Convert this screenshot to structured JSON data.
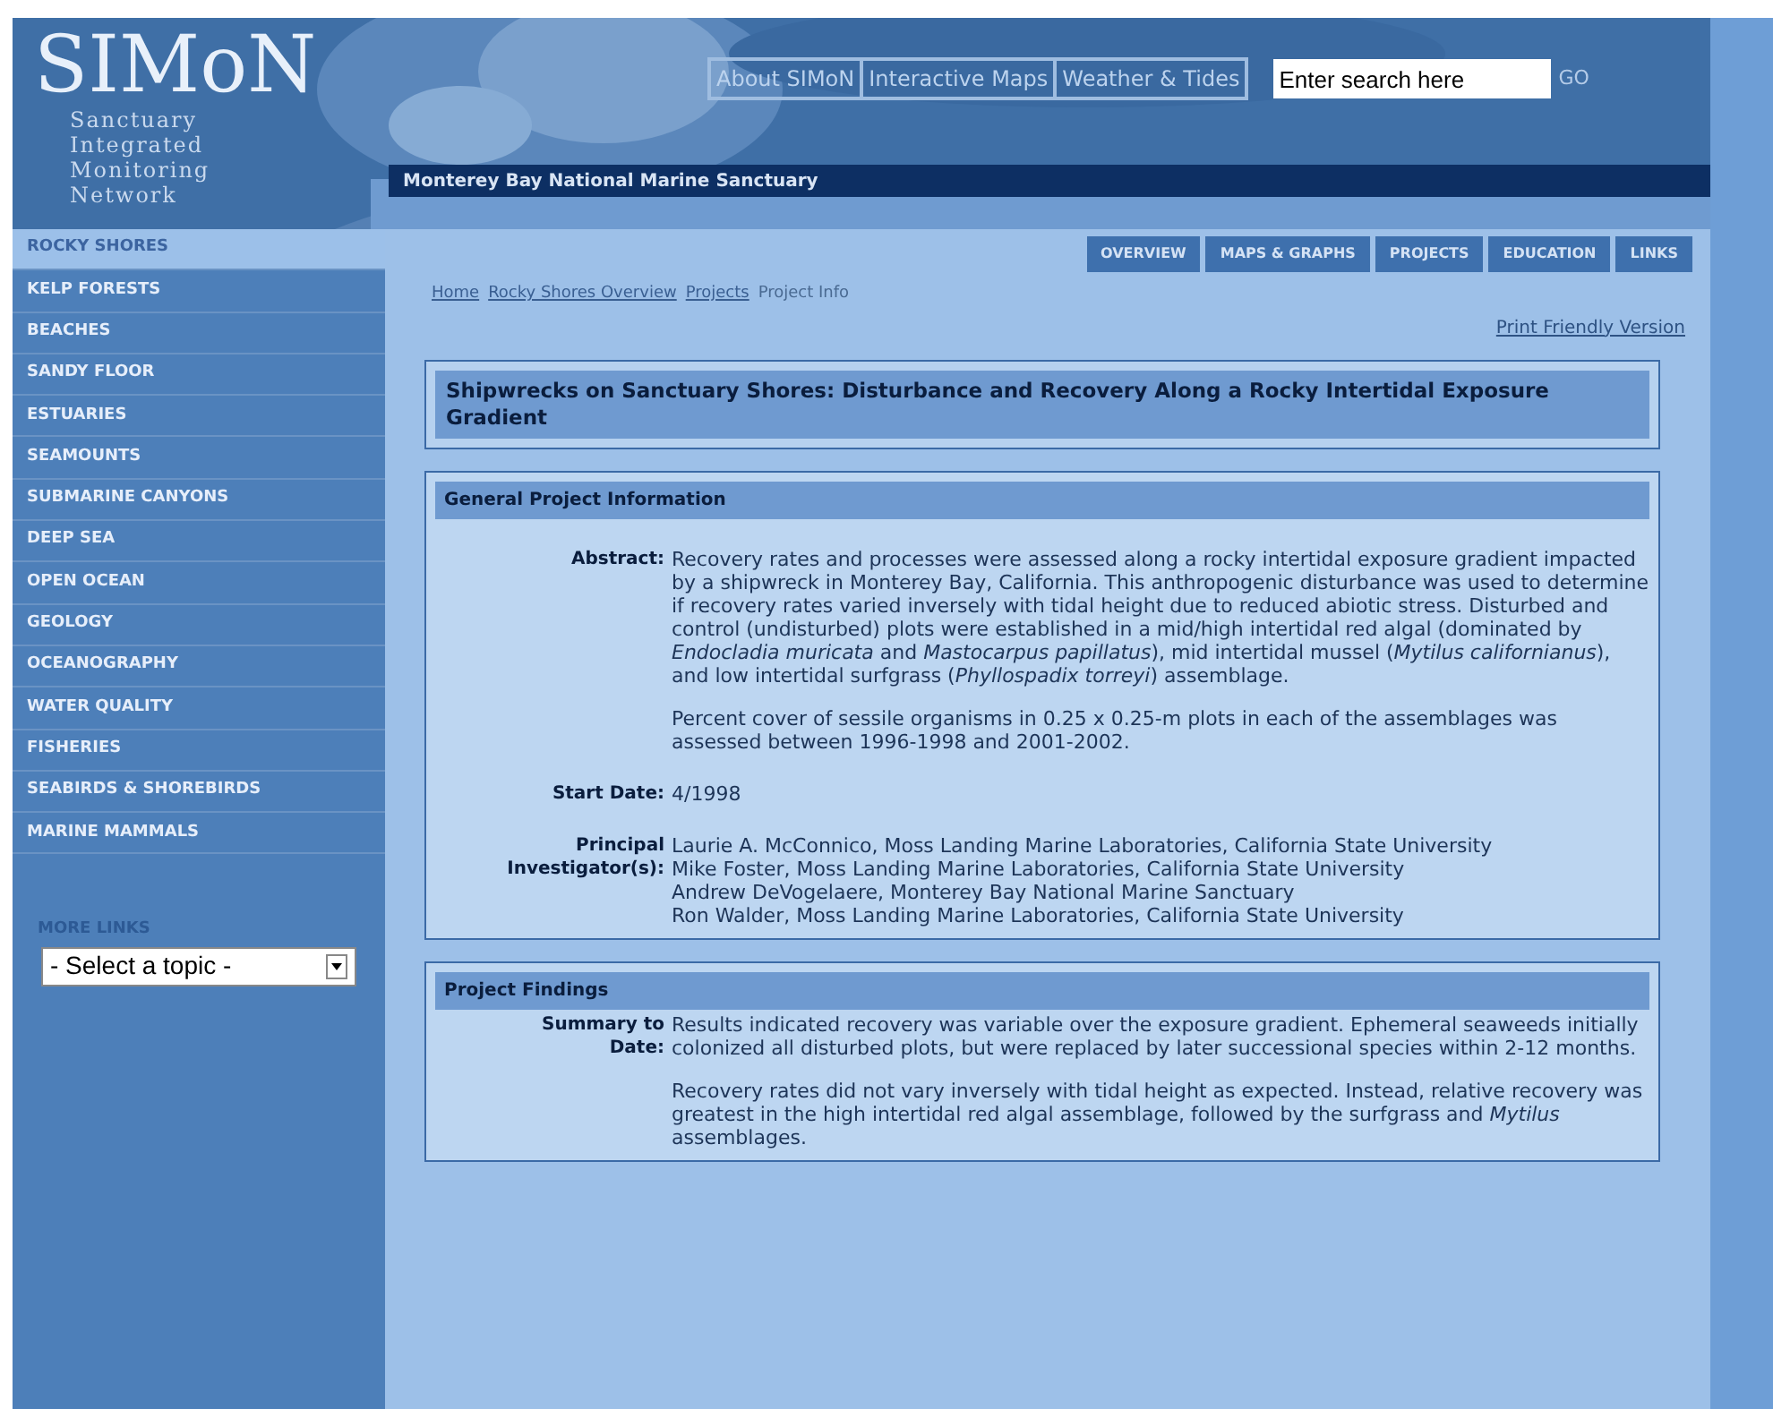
{
  "logo": {
    "title": "SIMoN",
    "subtitle": [
      "Sanctuary",
      "Integrated",
      "Monitoring",
      "Network"
    ]
  },
  "top_links": [
    "About SIMoN",
    "Interactive Maps",
    "Weather & Tides"
  ],
  "search": {
    "placeholder": "Enter search here",
    "button": "GO"
  },
  "banner": "Monterey Bay National Marine Sanctuary",
  "tabs": [
    {
      "label": "OVERVIEW",
      "selected": false
    },
    {
      "label": "MAPS & GRAPHS",
      "selected": false
    },
    {
      "label": "PROJECTS",
      "selected": false
    },
    {
      "label": "EDUCATION",
      "selected": false
    },
    {
      "label": "LINKS",
      "selected": false
    }
  ],
  "sidebar": {
    "items": [
      {
        "label": "ROCKY SHORES",
        "selected": true
      },
      {
        "label": "KELP FORESTS",
        "selected": false
      },
      {
        "label": "BEACHES",
        "selected": false
      },
      {
        "label": "SANDY FLOOR",
        "selected": false
      },
      {
        "label": "ESTUARIES",
        "selected": false
      },
      {
        "label": "SEAMOUNTS",
        "selected": false
      },
      {
        "label": "SUBMARINE CANYONS",
        "selected": false
      },
      {
        "label": "DEEP SEA",
        "selected": false
      },
      {
        "label": "OPEN OCEAN",
        "selected": false
      },
      {
        "label": "GEOLOGY",
        "selected": false
      },
      {
        "label": "OCEANOGRAPHY",
        "selected": false
      },
      {
        "label": "WATER QUALITY",
        "selected": false
      },
      {
        "label": "FISHERIES",
        "selected": false
      },
      {
        "label": "SEABIRDS & SHOREBIRDS",
        "selected": false
      },
      {
        "label": "MARINE MAMMALS",
        "selected": false
      }
    ],
    "more_links": {
      "label": "MORE LINKS",
      "value": "- Select a topic -"
    }
  },
  "breadcrumb": [
    {
      "label": "Home",
      "link": true
    },
    {
      "label": "Rocky Shores Overview",
      "link": true
    },
    {
      "label": "Projects",
      "link": true
    },
    {
      "label": "Project Info",
      "link": false
    }
  ],
  "print_link": "Print Friendly Version",
  "project_title": "Shipwrecks on Sanctuary Shores: Disturbance and Recovery Along a Rocky Intertidal Exposure Gradient",
  "sections": [
    {
      "title": "General Project Information",
      "fields": [
        {
          "label": "Abstract:",
          "compact": false,
          "paragraphs": [
            "Recovery rates and processes were assessed along a rocky intertidal exposure gradient impacted by a shipwreck in Monterey Bay, California. This anthropogenic disturbance was used to determine if recovery rates varied inversely with tidal height due to reduced abiotic stress. Disturbed and control (undisturbed) plots were established in a mid/high intertidal red algal (dominated by *Endocladia muricata* and *Mastocarpus papillatus*), mid intertidal mussel (*Mytilus californianus*), and low intertidal surfgrass (*Phyllospadix torreyi*) assemblage.",
            "Percent cover of sessile organisms in 0.25 x 0.25-m plots in each of the assemblages was assessed between 1996-1998 and 2001-2002."
          ]
        },
        {
          "label": "Start Date:",
          "paragraphs": [
            "4/1998"
          ]
        },
        {
          "label": "Principal Investigator(s):",
          "paragraphs": [
            "Laurie A. McConnico, Moss Landing Marine Laboratories, California State University",
            "Mike Foster, Moss Landing Marine Laboratories, California State University",
            "Andrew DeVogelaere, Monterey Bay National Marine Sanctuary",
            "Ron Walder, Moss Landing Marine Laboratories, California State University"
          ],
          "compact": true
        }
      ]
    },
    {
      "title": "Project Findings",
      "fields": [
        {
          "label": "Summary to Date:",
          "compact": false,
          "paragraphs": [
            "Results indicated recovery was variable over the exposure gradient. Ephemeral seaweeds initially colonized all disturbed plots, but were replaced by later successional species within 2-12 months.",
            "Recovery rates did not vary inversely with tidal height as expected. Instead, relative recovery was greatest in the high intertidal red algal assemblage, followed by the surfgrass and *Mytilus* assemblages."
          ]
        }
      ]
    }
  ]
}
